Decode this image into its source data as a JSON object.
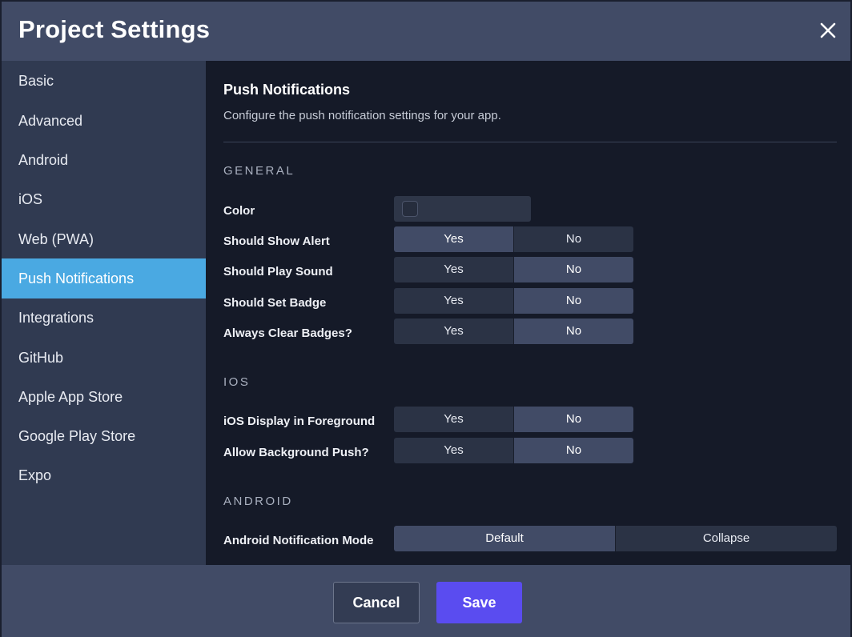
{
  "header": {
    "title": "Project Settings",
    "close_icon": "close-icon"
  },
  "sidebar": {
    "active_index": 5,
    "items": [
      {
        "label": "Basic"
      },
      {
        "label": "Advanced"
      },
      {
        "label": "Android"
      },
      {
        "label": "iOS"
      },
      {
        "label": "Web (PWA)"
      },
      {
        "label": "Push Notifications"
      },
      {
        "label": "Integrations"
      },
      {
        "label": "GitHub"
      },
      {
        "label": "Apple App Store"
      },
      {
        "label": "Google Play Store"
      },
      {
        "label": "Expo"
      }
    ]
  },
  "content": {
    "title": "Push Notifications",
    "description": "Configure the push notification settings for your app.",
    "groups": {
      "general": "GENERAL",
      "ios": "IOS",
      "android": "ANDROID"
    },
    "color": {
      "label": "Color"
    },
    "options": {
      "yes": "Yes",
      "no": "No",
      "default": "Default",
      "collapse": "Collapse"
    },
    "rows": {
      "should_show_alert": {
        "label": "Should Show Alert",
        "selected": "Yes"
      },
      "should_play_sound": {
        "label": "Should Play Sound",
        "selected": "No"
      },
      "should_set_badge": {
        "label": "Should Set Badge",
        "selected": "No"
      },
      "always_clear_badges": {
        "label": "Always Clear Badges?",
        "selected": "No"
      },
      "ios_display_foreground": {
        "label": "iOS Display in Foreground",
        "selected": "No"
      },
      "allow_background_push": {
        "label": "Allow Background Push?",
        "selected": "No"
      },
      "android_notification_mode": {
        "label": "Android Notification Mode",
        "selected": "Default"
      }
    }
  },
  "footer": {
    "cancel_label": "Cancel",
    "save_label": "Save"
  },
  "colors": {
    "header_bg": "#414b66",
    "sidebar_bg": "#303a51",
    "sidebar_active": "#4aa9e2",
    "content_bg": "#151a28",
    "segment_on": "#414b66",
    "segment_off": "#2b3345",
    "save_button": "#5a4cf0"
  }
}
